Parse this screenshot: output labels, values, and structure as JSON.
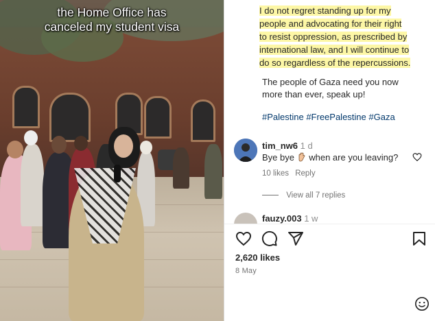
{
  "video": {
    "caption_line1": "the Home Office has",
    "caption_line2": "canceled my student visa"
  },
  "post": {
    "highlight_lines": [
      "I do not regret standing up for my",
      "people and advocating for their right",
      "to resist oppression, as prescribed by",
      "international law, and I will continue to",
      "do so regardless of the repercussions."
    ],
    "body_line1": "The people of Gaza need you now",
    "body_line2": "more than ever, speak up!",
    "hashtags": "#Palestine #FreePalestine #Gaza",
    "highlight_color": "#fdf7a6",
    "hashtag_color": "#00376b"
  },
  "comments": [
    {
      "username": "tim_nw6",
      "time": "1 d",
      "text_before": "Bye bye",
      "text_after": "when are you leaving?",
      "likes": "10 likes",
      "reply": "Reply",
      "view_replies": "View all 7 replies"
    },
    {
      "username": "fauzy.003",
      "time": "1 w"
    }
  ],
  "actions": {
    "like_icon": "heart-icon",
    "comment_icon": "comment-icon",
    "share_icon": "share-icon",
    "save_icon": "bookmark-icon"
  },
  "stats": {
    "likes": "2,620 likes",
    "date": "8 May"
  }
}
